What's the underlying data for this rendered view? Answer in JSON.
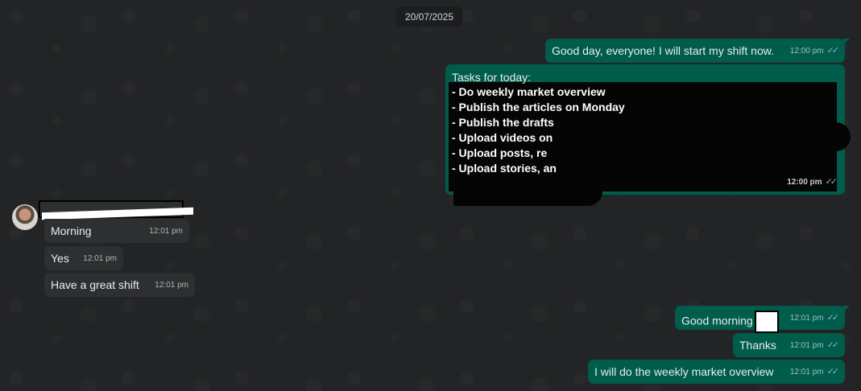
{
  "chat": {
    "date": "20/07/2025",
    "messages": [
      {
        "id": "m1",
        "direction": "out",
        "text": "Good day, everyone! I will start my shift now.",
        "time": "12:00 pm"
      },
      {
        "id": "m2",
        "direction": "out",
        "title": "Tasks for today:",
        "tasks": [
          "- Do weekly market overview",
          "- Publish the articles on Monday",
          "- Publish the drafts",
          "- Upload videos on",
          "- Upload posts, re",
          "- Upload stories, an"
        ],
        "time": "12:00 pm"
      },
      {
        "id": "m3",
        "direction": "in",
        "text": "Morning",
        "time": "12:01 pm"
      },
      {
        "id": "m4",
        "direction": "in",
        "text": "Yes",
        "time": "12:01 pm"
      },
      {
        "id": "m5",
        "direction": "in",
        "text": "Have a great shift",
        "time": "12:01 pm"
      },
      {
        "id": "m6",
        "direction": "out",
        "text": "Good morning",
        "time": "12:01 pm"
      },
      {
        "id": "m7",
        "direction": "out",
        "text": "Thanks",
        "time": "12:01 pm"
      },
      {
        "id": "m8",
        "direction": "out",
        "text": "I will do the weekly market overview",
        "time": "12:01 pm"
      }
    ]
  },
  "icons": {
    "read_receipt": "double-check-icon"
  },
  "colors": {
    "outgoing_bubble": "#005c4b",
    "incoming_bubble": "#2e2f30",
    "background": "#232425",
    "read_tick": "#7fb7d6"
  }
}
